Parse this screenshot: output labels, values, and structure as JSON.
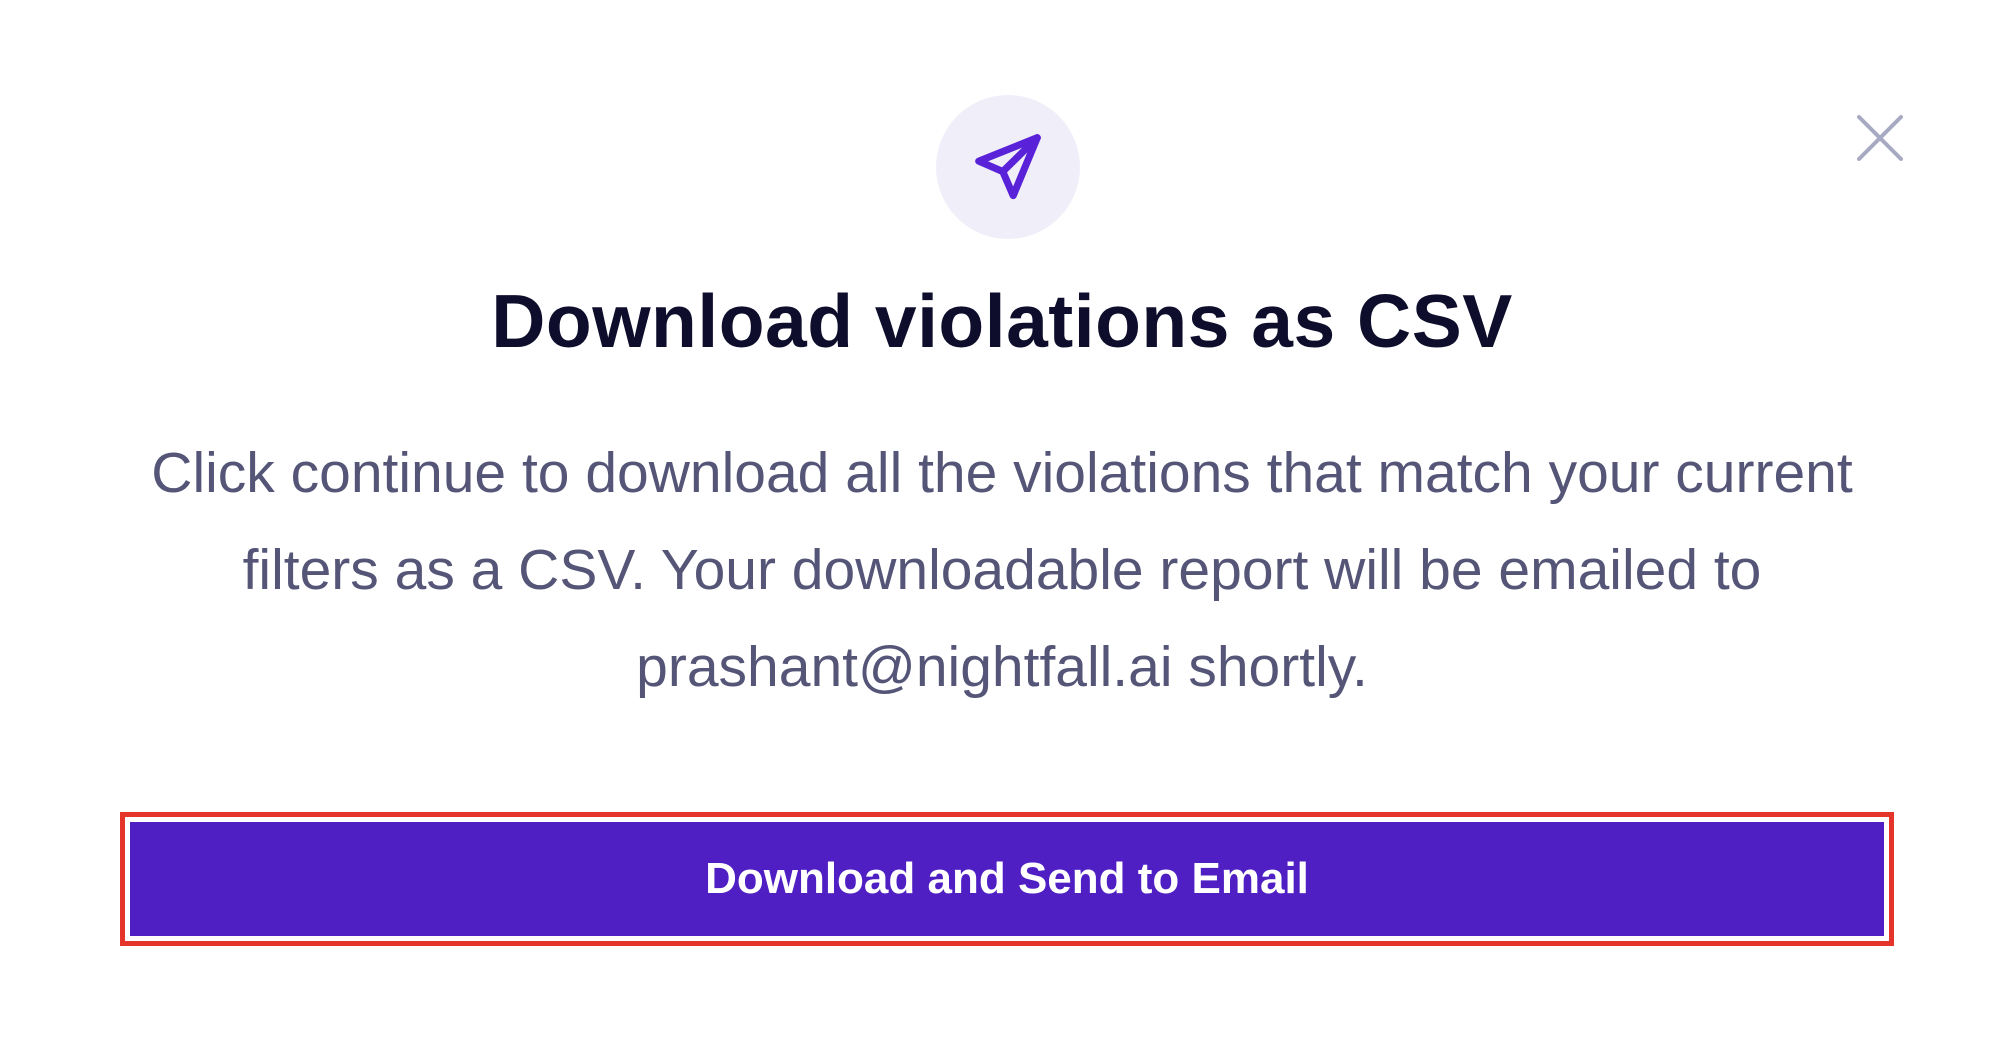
{
  "dialog": {
    "title": "Download violations as CSV",
    "body": "Click continue to download all the violations that match your current filters as a CSV. Your downloadable report will be emailed to prashant@nightfall.ai shortly.",
    "primary_button_label": "Download and Send to Email",
    "header_icon": "send-icon",
    "close_icon": "close-icon"
  },
  "colors": {
    "accent": "#4f1fc4",
    "icon_stroke": "#5a22d8",
    "icon_circle_bg": "#f0eef9",
    "highlight_border": "#e5352a",
    "title_text": "#0e0e2c",
    "body_text": "#545577",
    "close_icon": "#a8aac4"
  }
}
